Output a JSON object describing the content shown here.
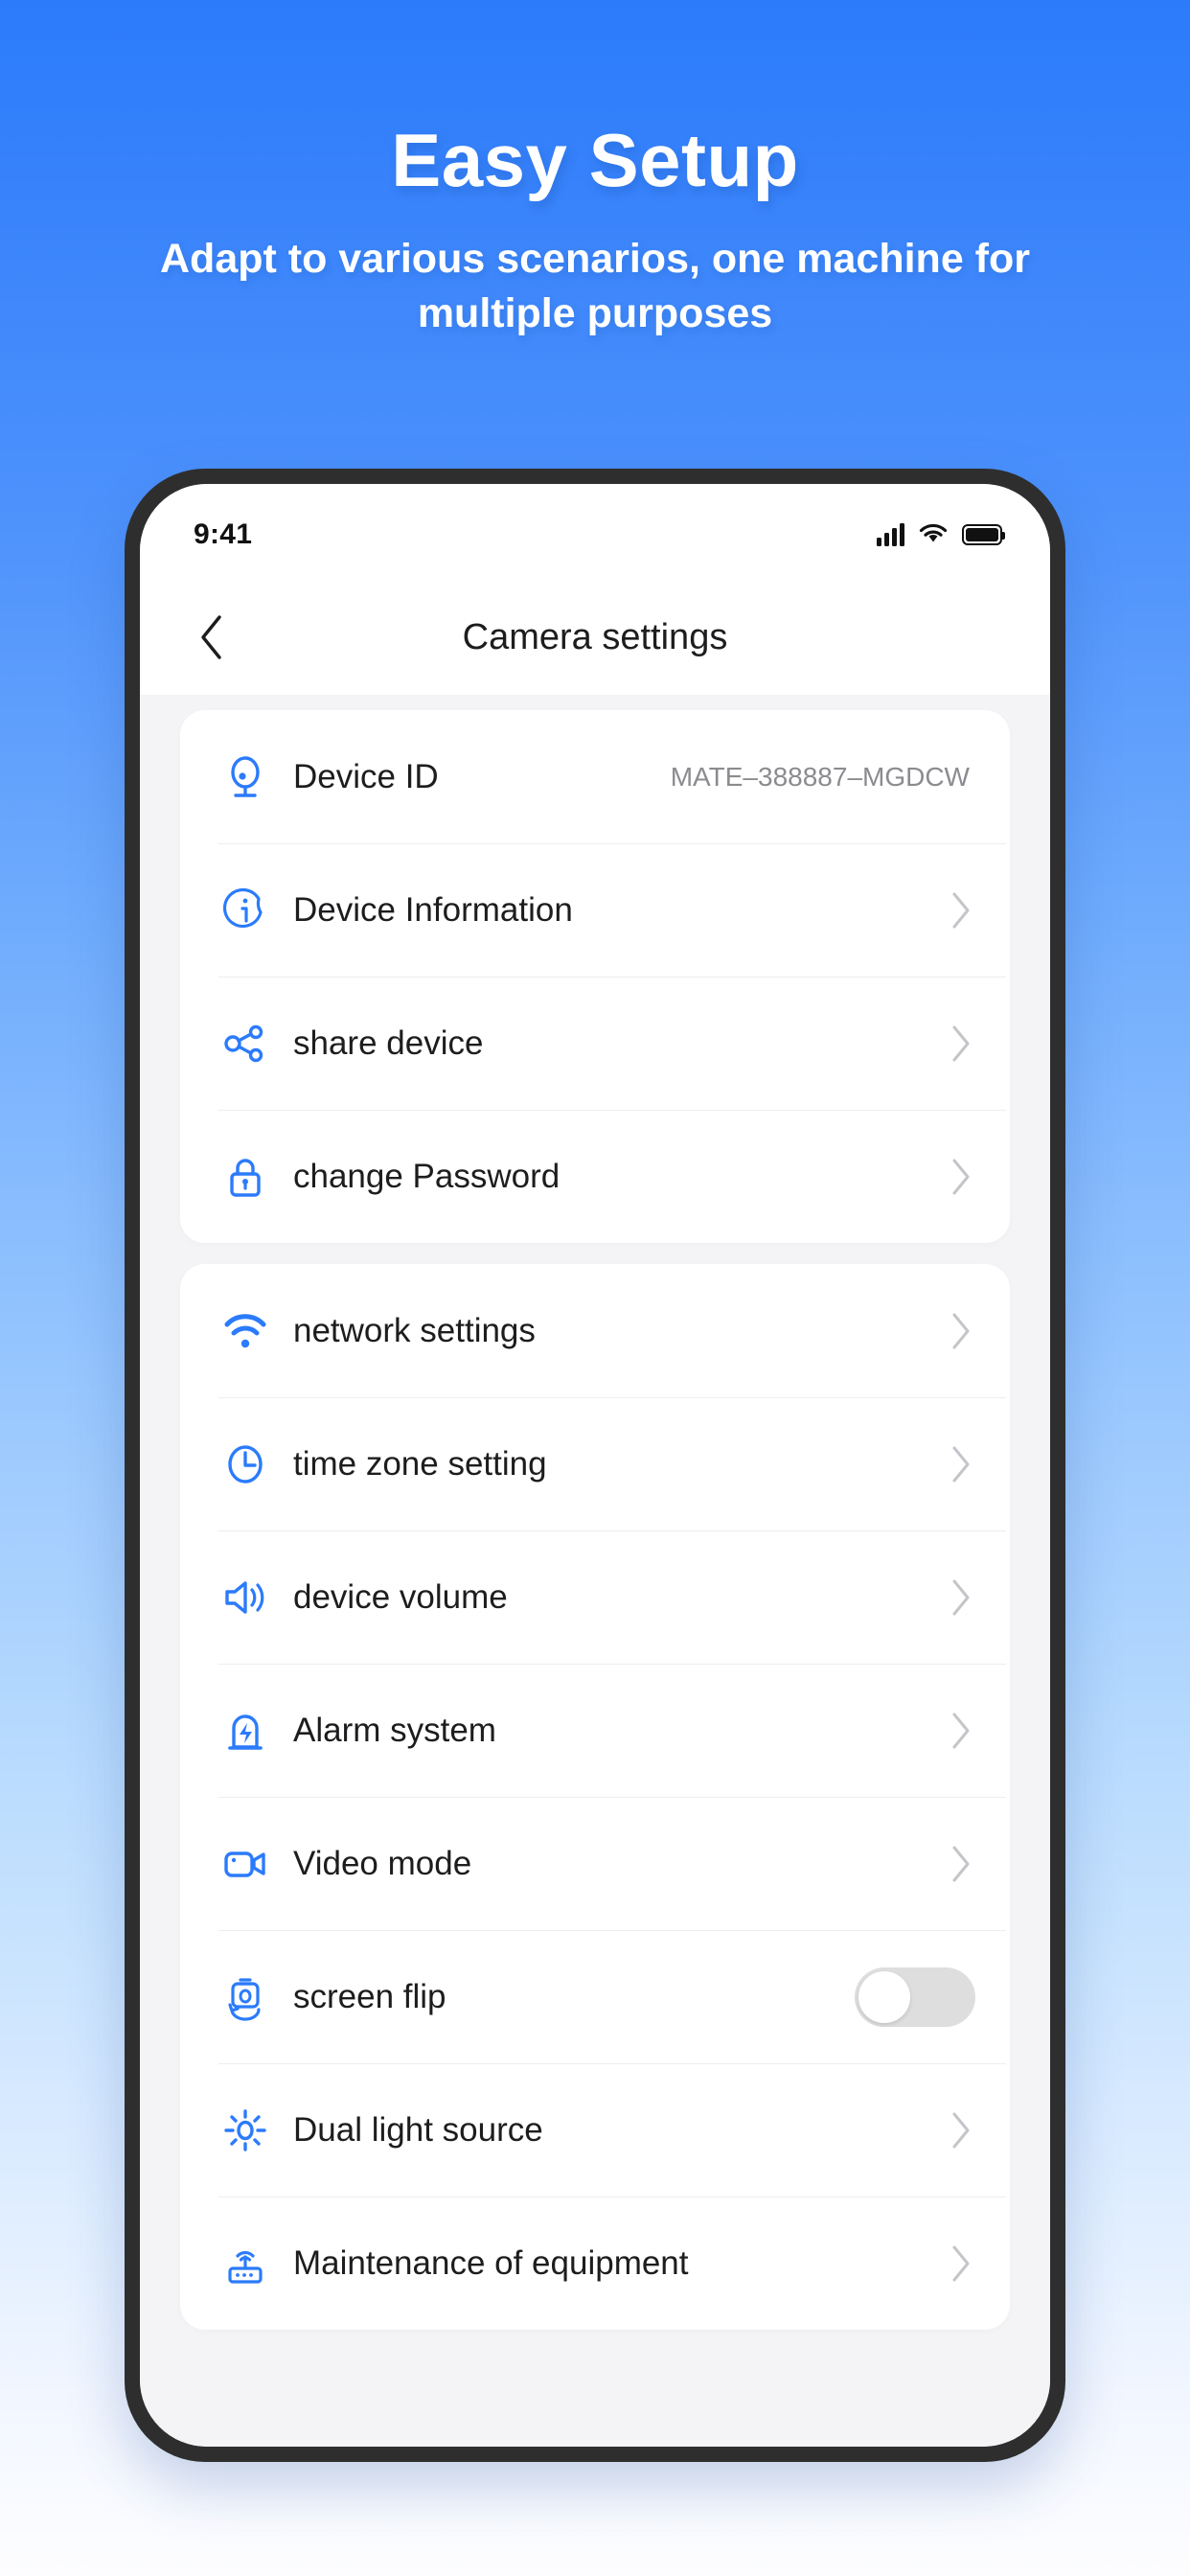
{
  "promo": {
    "title": "Easy Setup",
    "subtitle": "Adapt to various scenarios, one machine for multiple purposes",
    "accent_color": "#2b7bfb"
  },
  "phone": {
    "status_bar": {
      "time": "9:41",
      "signal_icon": "signal-bars-icon",
      "wifi_icon": "wifi-icon",
      "battery_icon": "battery-full-icon"
    },
    "nav": {
      "back_icon": "chevron-left-icon",
      "title": "Camera settings"
    },
    "sections": [
      {
        "rows": [
          {
            "icon": "camera-eye-icon",
            "label": "Device ID",
            "value": "MATE–388887–MGDCW",
            "control": "value"
          },
          {
            "icon": "info-circle-icon",
            "label": "Device Information",
            "control": "chevron"
          },
          {
            "icon": "share-nodes-icon",
            "label": "share device",
            "control": "chevron"
          },
          {
            "icon": "lock-icon",
            "label": "change Password",
            "control": "chevron"
          }
        ]
      },
      {
        "rows": [
          {
            "icon": "wifi-icon",
            "label": "network settings",
            "control": "chevron"
          },
          {
            "icon": "clock-icon",
            "label": "time zone setting",
            "control": "chevron"
          },
          {
            "icon": "speaker-volume-icon",
            "label": "device volume",
            "control": "chevron"
          },
          {
            "icon": "alarm-siren-icon",
            "label": "Alarm system",
            "control": "chevron"
          },
          {
            "icon": "video-camera-icon",
            "label": "Video mode",
            "control": "chevron"
          },
          {
            "icon": "screen-flip-icon",
            "label": "screen flip",
            "control": "toggle",
            "toggle_on": false
          },
          {
            "icon": "brightness-sun-icon",
            "label": "Dual light source",
            "control": "chevron"
          },
          {
            "icon": "router-maintenance-icon",
            "label": "Maintenance of equipment",
            "control": "chevron"
          }
        ]
      }
    ]
  },
  "colors": {
    "icon_blue": "#2b7bfb",
    "chevron_gray": "#c3c5c9",
    "toggle_off_track": "#dededf"
  }
}
